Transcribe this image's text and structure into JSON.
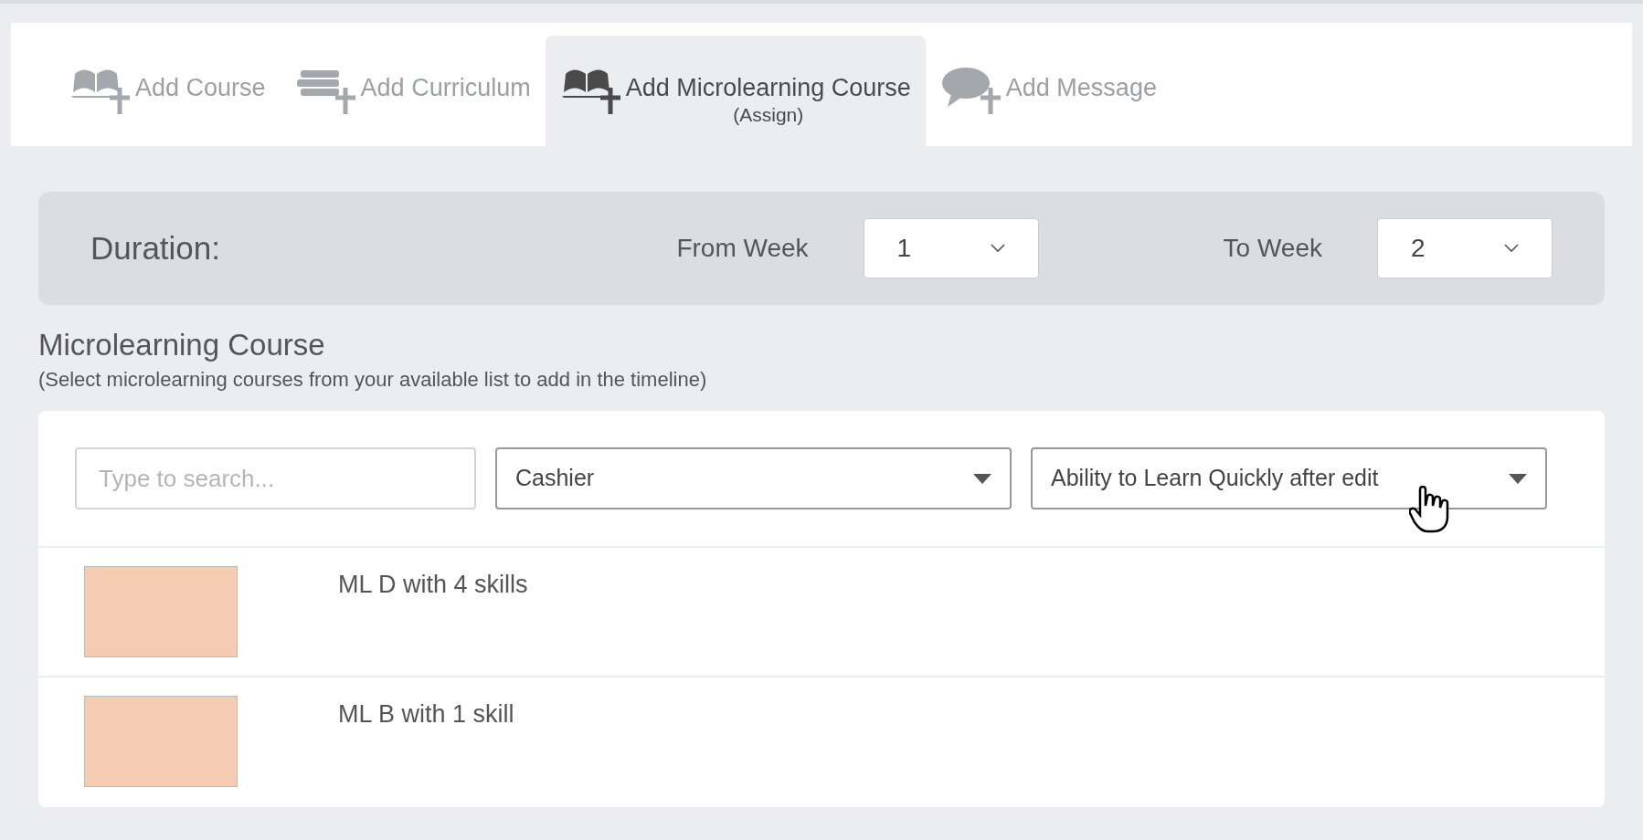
{
  "tabs": [
    {
      "kind": "course",
      "label": "Add Course",
      "selected": false
    },
    {
      "kind": "curriculum",
      "label": "Add Curriculum",
      "selected": false
    },
    {
      "kind": "microlearning",
      "label": "Add Microlearning Course",
      "sublabel": "(Assign)",
      "selected": true
    },
    {
      "kind": "message",
      "label": "Add Message",
      "selected": false
    }
  ],
  "duration": {
    "label": "Duration:",
    "from_label": "From Week",
    "from_value": "1",
    "to_label": "To Week",
    "to_value": "2"
  },
  "section": {
    "title": "Microlearning Course",
    "subtitle": "(Select microlearning courses from your available list to add in the timeline)"
  },
  "filters": {
    "search": {
      "placeholder": "Type to search..."
    },
    "role": {
      "value": "Cashier"
    },
    "skill": {
      "value": "Ability to Learn Quickly after edit"
    }
  },
  "courses": [
    {
      "title": "ML D with 4 skills"
    },
    {
      "title": "ML B with 1 skill"
    }
  ]
}
